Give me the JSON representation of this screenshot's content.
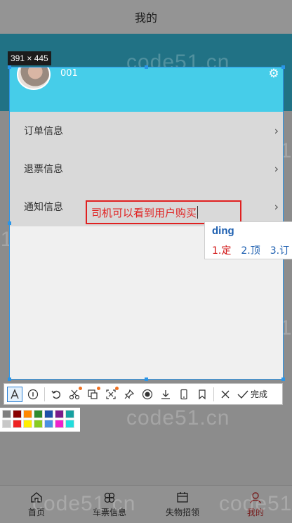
{
  "app": {
    "title": "我的",
    "tabs": [
      {
        "label": "首页",
        "icon": "home-icon"
      },
      {
        "label": "车票信息",
        "icon": "clover-icon"
      },
      {
        "label": "失物招领",
        "icon": "calendar-icon"
      },
      {
        "label": "我的",
        "icon": "user-icon"
      }
    ]
  },
  "watermark": "code51.cn",
  "selection": {
    "size_label": "391 × 445"
  },
  "profile": {
    "username": "001"
  },
  "menu": [
    {
      "label": "订单信息"
    },
    {
      "label": "退票信息"
    },
    {
      "label": "通知信息"
    }
  ],
  "annotation": {
    "text": "司机可以看到用户购买"
  },
  "ime": {
    "input": "ding",
    "candidates": [
      "1.定",
      "2.顶",
      "3.订"
    ]
  },
  "toolbar": {
    "done_label": "完成"
  },
  "palette": {
    "row1": [
      "#7f7f7f",
      "#880000",
      "#ff8800",
      "#2e8b2e",
      "#1e4fa8",
      "#7a1a8a",
      "#16a0a0"
    ],
    "row2": [
      "#c8c8c8",
      "#ee2222",
      "#ffee00",
      "#88cc22",
      "#4a90e2",
      "#ee22cc",
      "#22dddd"
    ]
  }
}
